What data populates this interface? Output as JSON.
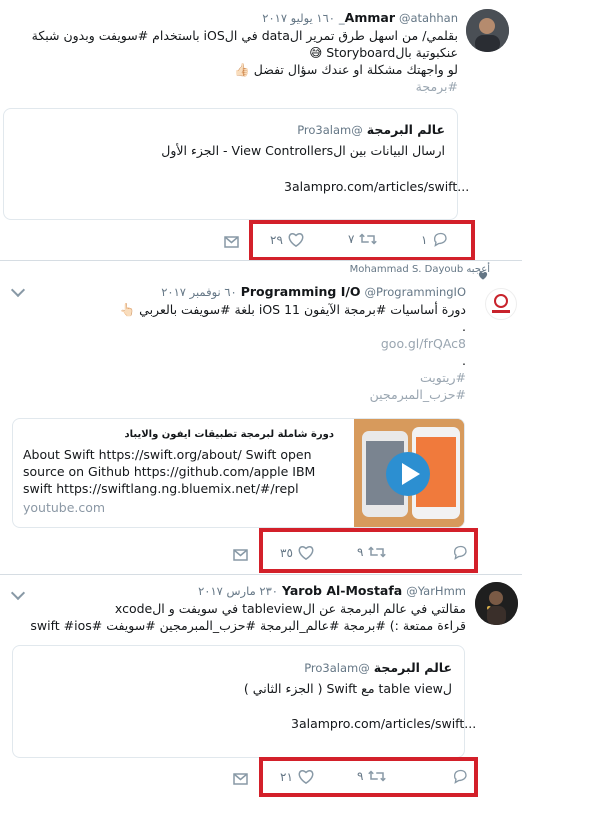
{
  "tweets": [
    {
      "name": "Ammar",
      "handle": "@atahhan_",
      "date": "١٦٠ يوليو ٢٠١٧",
      "text_lines": [
        "بقلمي/ من اسهل طرق تمرير الdata في الiOS باستخدام #سويفت وبدون شبكة",
        "عنكبوتية بالStoryboard 😅",
        "لو واجهتك مشكلة او عندك سؤال تفضل 👍🏻"
      ],
      "hashtag": "#برمجة",
      "card": {
        "title": "عالم البرمجة",
        "handle": "@Pro3alam",
        "desc": "ارسال البيانات بين الView Controllers - الجزء الأول",
        "url": "3alampro.com/articles/swift..."
      },
      "actions": {
        "reply": "١",
        "retweet": "٧",
        "like": "٢٩"
      }
    },
    {
      "liked_by": "Mohammad S. Dayoub أعجبه",
      "name": "Programming I/O",
      "handle": "@ProgrammingIO",
      "date": "٦٠ نوفمبر ٢٠١٧",
      "text_lines": [
        "دورة أساسيات #برمجة الآيفون iOS 11 بلغة #سويفت بالعربي 👆🏻",
        ".",
        "goo.gl/frQAc8",
        ".",
        "#ريتويت",
        "#حزب_المبرمجين"
      ],
      "card": {
        "title": "دورة شاملة لبرمجة تطبيقات ايفون والايباد",
        "desc": "About Swift https://swift.org/about/ Swift open source on Github https://github.com/apple IBM swift https://swiftlang.ng.bluemix.net/#/repl ========== ...اعم",
        "url": "youtube.com"
      },
      "actions": {
        "reply": "",
        "retweet": "٩",
        "like": "٣٥"
      }
    },
    {
      "name": "Yarob Al-Mostafa",
      "handle": "@YarHmm",
      "date": "٢٣٠ مارس ٢٠١٧",
      "text_lines": [
        "مقالتي في عالم البرمجة عن الtableview في سويفت و الxcode",
        "قراءة ممتعة :) #برمجة #عالم_البرمجة #حزب_المبرمجين #سويفت #swift #ios"
      ],
      "card": {
        "title": "عالم البرمجة",
        "handle": "@Pro3alam",
        "desc": "لtable view مع Swift ( الجزء الثاني )",
        "url": "3alampro.com/articles/swift..."
      },
      "actions": {
        "reply": "",
        "retweet": "٩",
        "like": "٢١"
      }
    }
  ],
  "colors": {
    "highlight_box": "#d3202a",
    "link": "#9aa6b1",
    "text": "#14171a"
  },
  "icons": [
    "reply-icon",
    "retweet-icon",
    "like-icon",
    "message-icon",
    "caret-down-icon",
    "heart-icon"
  ]
}
